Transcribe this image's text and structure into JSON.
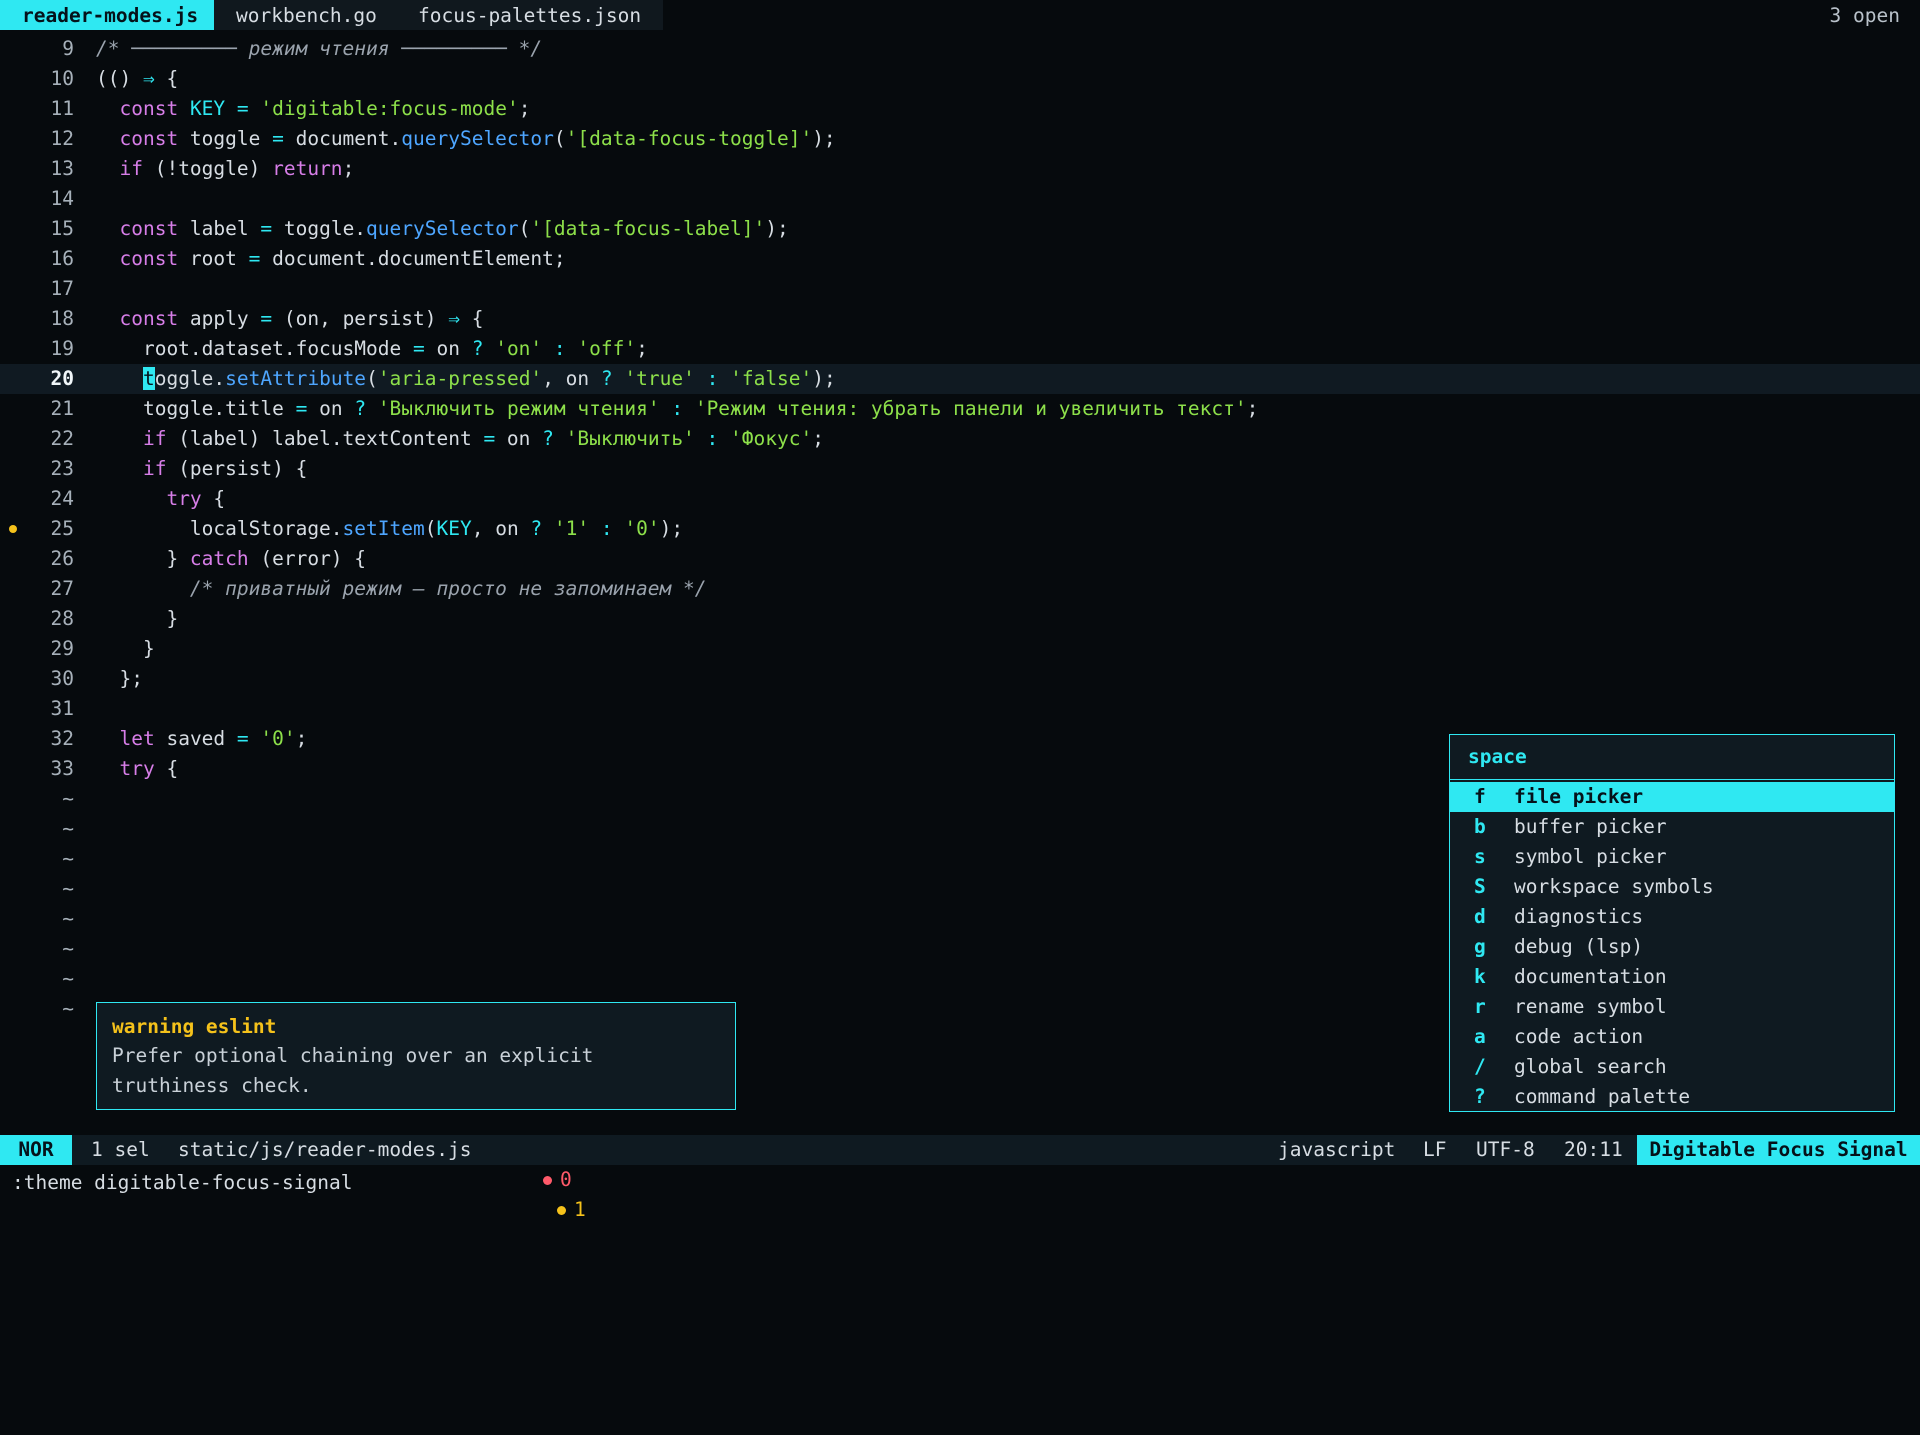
{
  "tabs": [
    {
      "label": "reader-modes.js",
      "active": true
    },
    {
      "label": "workbench.go",
      "active": false
    },
    {
      "label": "focus-palettes.json",
      "active": false
    }
  ],
  "open_count": "3 open",
  "editor": {
    "current_line": 20,
    "lines": [
      {
        "n": "9",
        "tokens": [
          [
            "c",
            "/* ───────── режим чтения ───────── */"
          ]
        ]
      },
      {
        "n": "10",
        "tokens": [
          [
            "p",
            "(() "
          ],
          [
            "o",
            "⇒"
          ],
          [
            "p",
            " {"
          ]
        ]
      },
      {
        "n": "11",
        "tokens": [
          [
            "p",
            "  "
          ],
          [
            "k",
            "const"
          ],
          [
            "p",
            " "
          ],
          [
            "cst",
            "KEY"
          ],
          [
            "p",
            " "
          ],
          [
            "o",
            "="
          ],
          [
            "p",
            " "
          ],
          [
            "s",
            "'digitable:focus-mode'"
          ],
          [
            "p",
            ";"
          ]
        ]
      },
      {
        "n": "12",
        "tokens": [
          [
            "p",
            "  "
          ],
          [
            "k",
            "const"
          ],
          [
            "p",
            " toggle "
          ],
          [
            "o",
            "="
          ],
          [
            "p",
            " document."
          ],
          [
            "f",
            "querySelector"
          ],
          [
            "p",
            "("
          ],
          [
            "s",
            "'[data-focus-toggle]'"
          ],
          [
            "p",
            ");"
          ]
        ]
      },
      {
        "n": "13",
        "tokens": [
          [
            "p",
            "  "
          ],
          [
            "k",
            "if"
          ],
          [
            "p",
            " (!toggle) "
          ],
          [
            "k",
            "return"
          ],
          [
            "p",
            ";"
          ]
        ]
      },
      {
        "n": "14",
        "tokens": []
      },
      {
        "n": "15",
        "tokens": [
          [
            "p",
            "  "
          ],
          [
            "k",
            "const"
          ],
          [
            "p",
            " label "
          ],
          [
            "o",
            "="
          ],
          [
            "p",
            " toggle."
          ],
          [
            "f",
            "querySelector"
          ],
          [
            "p",
            "("
          ],
          [
            "s",
            "'[data-focus-label]'"
          ],
          [
            "p",
            ");"
          ]
        ]
      },
      {
        "n": "16",
        "tokens": [
          [
            "p",
            "  "
          ],
          [
            "k",
            "const"
          ],
          [
            "p",
            " root "
          ],
          [
            "o",
            "="
          ],
          [
            "p",
            " document.documentElement;"
          ]
        ]
      },
      {
        "n": "17",
        "tokens": []
      },
      {
        "n": "18",
        "tokens": [
          [
            "p",
            "  "
          ],
          [
            "k",
            "const"
          ],
          [
            "p",
            " apply "
          ],
          [
            "o",
            "="
          ],
          [
            "p",
            " (on, persist) "
          ],
          [
            "o",
            "⇒"
          ],
          [
            "p",
            " {"
          ]
        ]
      },
      {
        "n": "19",
        "tokens": [
          [
            "p",
            "    root.dataset.focusMode "
          ],
          [
            "o",
            "="
          ],
          [
            "p",
            " on "
          ],
          [
            "o",
            "?"
          ],
          [
            "p",
            " "
          ],
          [
            "s",
            "'on'"
          ],
          [
            "p",
            " "
          ],
          [
            "o",
            ":"
          ],
          [
            "p",
            " "
          ],
          [
            "s",
            "'off'"
          ],
          [
            "p",
            ";"
          ]
        ]
      },
      {
        "n": "20",
        "tokens": [
          [
            "p",
            "    "
          ],
          [
            "cur",
            "t"
          ],
          [
            "p",
            "oggle."
          ],
          [
            "f",
            "setAttribute"
          ],
          [
            "p",
            "("
          ],
          [
            "s",
            "'aria-pressed'"
          ],
          [
            "p",
            ", on "
          ],
          [
            "o",
            "?"
          ],
          [
            "p",
            " "
          ],
          [
            "s",
            "'true'"
          ],
          [
            "p",
            " "
          ],
          [
            "o",
            ":"
          ],
          [
            "p",
            " "
          ],
          [
            "s",
            "'false'"
          ],
          [
            "p",
            ");"
          ]
        ]
      },
      {
        "n": "21",
        "tokens": [
          [
            "p",
            "    toggle.title "
          ],
          [
            "o",
            "="
          ],
          [
            "p",
            " on "
          ],
          [
            "o",
            "?"
          ],
          [
            "p",
            " "
          ],
          [
            "s",
            "'Выключить режим чтения'"
          ],
          [
            "p",
            " "
          ],
          [
            "o",
            ":"
          ],
          [
            "p",
            " "
          ],
          [
            "s",
            "'Режим чтения: убрать панели и увеличить текст'"
          ],
          [
            "p",
            ";"
          ]
        ]
      },
      {
        "n": "22",
        "tokens": [
          [
            "p",
            "    "
          ],
          [
            "k",
            "if"
          ],
          [
            "p",
            " (label) label.textContent "
          ],
          [
            "o",
            "="
          ],
          [
            "p",
            " on "
          ],
          [
            "o",
            "?"
          ],
          [
            "p",
            " "
          ],
          [
            "s",
            "'Выключить'"
          ],
          [
            "p",
            " "
          ],
          [
            "o",
            ":"
          ],
          [
            "p",
            " "
          ],
          [
            "s",
            "'Фокус'"
          ],
          [
            "p",
            ";"
          ]
        ]
      },
      {
        "n": "23",
        "tokens": [
          [
            "p",
            "    "
          ],
          [
            "k",
            "if"
          ],
          [
            "p",
            " (persist) {"
          ]
        ]
      },
      {
        "n": "24",
        "tokens": [
          [
            "p",
            "      "
          ],
          [
            "k",
            "try"
          ],
          [
            "p",
            " {"
          ]
        ]
      },
      {
        "n": "25",
        "mark": "warning",
        "tokens": [
          [
            "p",
            "        localStorage."
          ],
          [
            "f",
            "setItem"
          ],
          [
            "p",
            "("
          ],
          [
            "cst",
            "KEY"
          ],
          [
            "p",
            ", on "
          ],
          [
            "o",
            "?"
          ],
          [
            "p",
            " "
          ],
          [
            "s",
            "'1'"
          ],
          [
            "p",
            " "
          ],
          [
            "o",
            ":"
          ],
          [
            "p",
            " "
          ],
          [
            "s",
            "'0'"
          ],
          [
            "p",
            ");"
          ]
        ]
      },
      {
        "n": "26",
        "tokens": [
          [
            "p",
            "      } "
          ],
          [
            "k",
            "catch"
          ],
          [
            "p",
            " (error) {"
          ]
        ]
      },
      {
        "n": "27",
        "tokens": [
          [
            "p",
            "        "
          ],
          [
            "c",
            "/* приватный режим — просто не запоминаем */"
          ]
        ]
      },
      {
        "n": "28",
        "tokens": [
          [
            "p",
            "      }"
          ]
        ]
      },
      {
        "n": "29",
        "tokens": [
          [
            "p",
            "    }"
          ]
        ]
      },
      {
        "n": "30",
        "tokens": [
          [
            "p",
            "  };"
          ]
        ]
      },
      {
        "n": "31",
        "tokens": []
      },
      {
        "n": "32",
        "tokens": [
          [
            "p",
            "  "
          ],
          [
            "k",
            "let"
          ],
          [
            "p",
            " saved "
          ],
          [
            "o",
            "="
          ],
          [
            "p",
            " "
          ],
          [
            "s",
            "'0'"
          ],
          [
            "p",
            ";"
          ]
        ]
      },
      {
        "n": "33",
        "tokens": [
          [
            "p",
            "  "
          ],
          [
            "k",
            "try"
          ],
          [
            "p",
            " {"
          ]
        ]
      }
    ],
    "filler_lines": 8,
    "filler_glyph": "~"
  },
  "diagnostic": {
    "title": "warning eslint",
    "body": "Prefer optional chaining over an explicit truthiness check."
  },
  "space_menu": {
    "title": "space",
    "items": [
      {
        "key": "f",
        "label": "file picker",
        "selected": true
      },
      {
        "key": "b",
        "label": "buffer picker"
      },
      {
        "key": "s",
        "label": "symbol picker"
      },
      {
        "key": "S",
        "label": "workspace symbols"
      },
      {
        "key": "d",
        "label": "diagnostics"
      },
      {
        "key": "g",
        "label": "debug (lsp)"
      },
      {
        "key": "k",
        "label": "documentation"
      },
      {
        "key": "r",
        "label": "rename symbol"
      },
      {
        "key": "a",
        "label": "code action"
      },
      {
        "key": "/",
        "label": "global search"
      },
      {
        "key": "?",
        "label": "command palette"
      }
    ]
  },
  "statusline": {
    "mode": "NOR",
    "selections": "1 sel",
    "file": "static/js/reader-modes.js",
    "errors": "0",
    "warnings": "1",
    "language": "javascript",
    "line_ending": "LF",
    "encoding": "UTF-8",
    "position": "20:11",
    "theme_name": "Digitable Focus Signal"
  },
  "command_line": ":theme digitable-focus-signal",
  "colors": {
    "accent": "#2fe8f2",
    "background": "#060a0d",
    "keyword": "#d77ee8",
    "string": "#8de04a",
    "function": "#4ea6ff",
    "warning": "#f5c21b",
    "error": "#ff5a6a"
  }
}
